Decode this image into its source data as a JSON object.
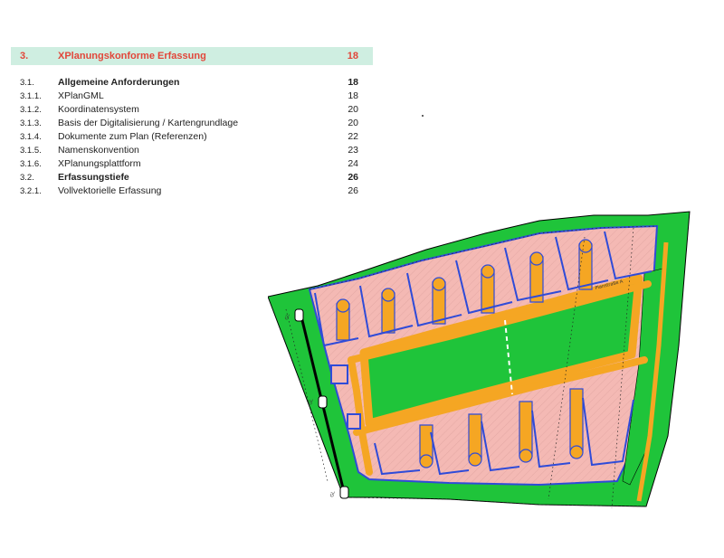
{
  "toc": {
    "header": {
      "number": "3.",
      "title": "XPlanungskonforme Erfassung",
      "page": "18"
    },
    "entries": [
      {
        "number": "3.1.",
        "title": "Allgemeine Anforderungen",
        "page": "18",
        "level": 2
      },
      {
        "number": "3.1.1.",
        "title": "XPlanGML",
        "page": "18",
        "level": 3
      },
      {
        "number": "3.1.2.",
        "title": "Koordinatensystem",
        "page": "20",
        "level": 3
      },
      {
        "number": "3.1.3.",
        "title": "Basis der Digitalisierung / Kartengrundlage",
        "page": "20",
        "level": 3
      },
      {
        "number": "3.1.4.",
        "title": "Dokumente zum Plan (Referenzen)",
        "page": "22",
        "level": 3
      },
      {
        "number": "3.1.5.",
        "title": "Namenskonvention",
        "page": "23",
        "level": 3
      },
      {
        "number": "3.1.6.",
        "title": "XPlanungsplattform",
        "page": "24",
        "level": 3
      },
      {
        "number": "3.2.",
        "title": "Erfassungstiefe",
        "page": "26",
        "level": 2
      },
      {
        "number": "3.2.1.",
        "title": "Vollvektorielle Erfassung",
        "page": "26",
        "level": 3
      }
    ]
  },
  "plan": {
    "street_label": "Planstraße A",
    "boundary_markers": [
      "GL",
      "GL",
      "GL"
    ],
    "colors": {
      "green_space": "#1fc43a",
      "road": "#f5a623",
      "building_plot": "#f4b9b4",
      "boundary": "#2f4bd8"
    }
  }
}
